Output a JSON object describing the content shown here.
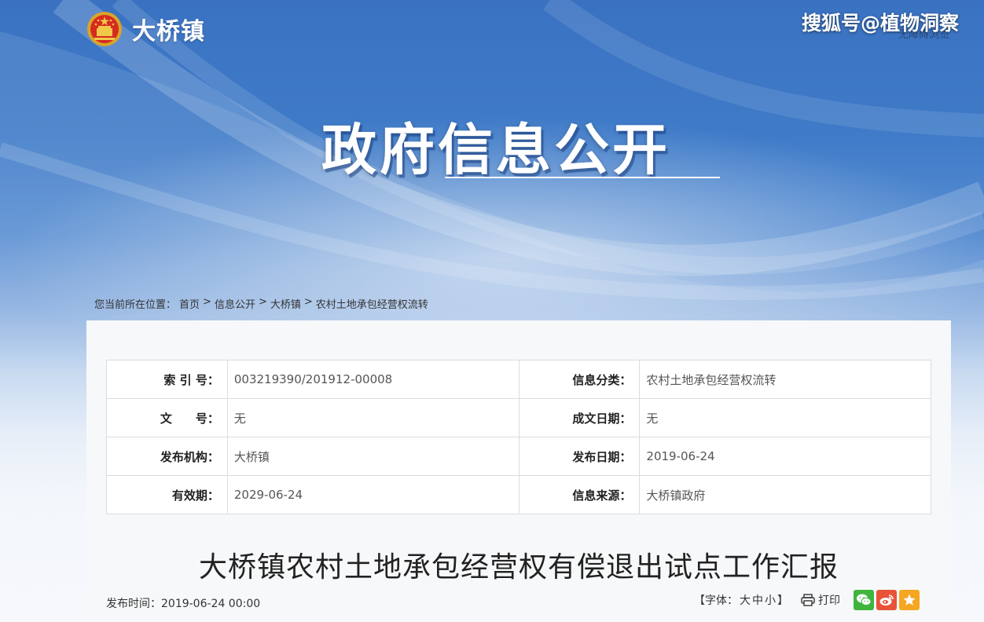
{
  "site": {
    "name": "大桥镇",
    "watermark": "搜狐号@植物洞察",
    "watermark_sub": "无障碍浏览"
  },
  "hero": {
    "title": "政府信息公开"
  },
  "breadcrumb": {
    "prefix": "您当前所在位置：",
    "items": [
      "首页",
      "信息公开",
      "大桥镇",
      "农村土地承包经营权流转"
    ],
    "separator": ">"
  },
  "meta": {
    "rows": [
      [
        {
          "label": "索 引 号：",
          "value": "003219390/201912-00008"
        },
        {
          "label": "信息分类：",
          "value": "农村土地承包经营权流转"
        }
      ],
      [
        {
          "label": "文　　号：",
          "value": "无"
        },
        {
          "label": "成文日期：",
          "value": "无"
        }
      ],
      [
        {
          "label": "发布机构：",
          "value": "大桥镇"
        },
        {
          "label": "发布日期：",
          "value": "2019-06-24"
        }
      ],
      [
        {
          "label": "有效期：",
          "value": "2029-06-24"
        },
        {
          "label": "信息来源：",
          "value": "大桥镇政府"
        }
      ]
    ]
  },
  "article": {
    "title": "大桥镇农村土地承包经营权有偿退出试点工作汇报",
    "publish_time": "发布时间：2019-06-24 00:00"
  },
  "tools": {
    "font_prefix": "【字体：",
    "font_large": "大",
    "font_medium": "中",
    "font_small": "小",
    "font_suffix": "】",
    "print_label": "打印",
    "share_icons": [
      "wechat-icon",
      "weibo-icon",
      "star-icon"
    ]
  },
  "colors": {
    "banner_blue": "#3a72c1",
    "wechat_green": "#3fb53f",
    "weibo_red": "#e8533a",
    "favorite_orange": "#f5a623"
  }
}
